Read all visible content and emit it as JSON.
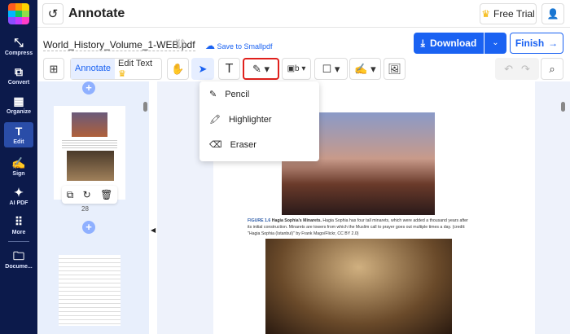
{
  "sidebar": {
    "items": [
      {
        "label": "Compress",
        "icon": "compress-icon"
      },
      {
        "label": "Convert",
        "icon": "convert-icon"
      },
      {
        "label": "Organize",
        "icon": "organize-icon"
      },
      {
        "label": "Edit",
        "icon": "text-icon"
      },
      {
        "label": "Sign",
        "icon": "signature-icon"
      },
      {
        "label": "AI PDF",
        "icon": "sparkle-icon"
      },
      {
        "label": "More",
        "icon": "grid-icon"
      },
      {
        "label": "Docume...",
        "icon": "folder-icon"
      }
    ],
    "active": "Edit"
  },
  "header": {
    "title": "Annotate",
    "free_trial": "Free Trial"
  },
  "doc": {
    "filename": "World_History_Volume_1-WEB.pdf",
    "save_label": "Save to Smallpdf",
    "download": "Download",
    "finish": "Finish"
  },
  "toolbar": {
    "annotate": "Annotate",
    "edit_text": "Edit Text"
  },
  "menu": {
    "items": [
      "Pencil",
      "Highlighter",
      "Eraser"
    ]
  },
  "thumbs": {
    "page_number": "28"
  },
  "page": {
    "caption_label": "FIGURE 1.6",
    "caption_title": "Hagia Sophia's Minarets.",
    "caption_text": "Hagia Sophia has four tall minarets, which were added a thousand years after its initial construction. Minarets are towers from which the Muslim call to prayer goes out multiple times a day.",
    "caption_credit": "(credit: \"Hagia Sophia (Istanbul)\" by Frank Mago/Flickr, CC BY 2.0)"
  },
  "colors": {
    "brand": "#1a62f2",
    "sidebar": "#0c1a4b",
    "highlight": "#e0201c"
  }
}
